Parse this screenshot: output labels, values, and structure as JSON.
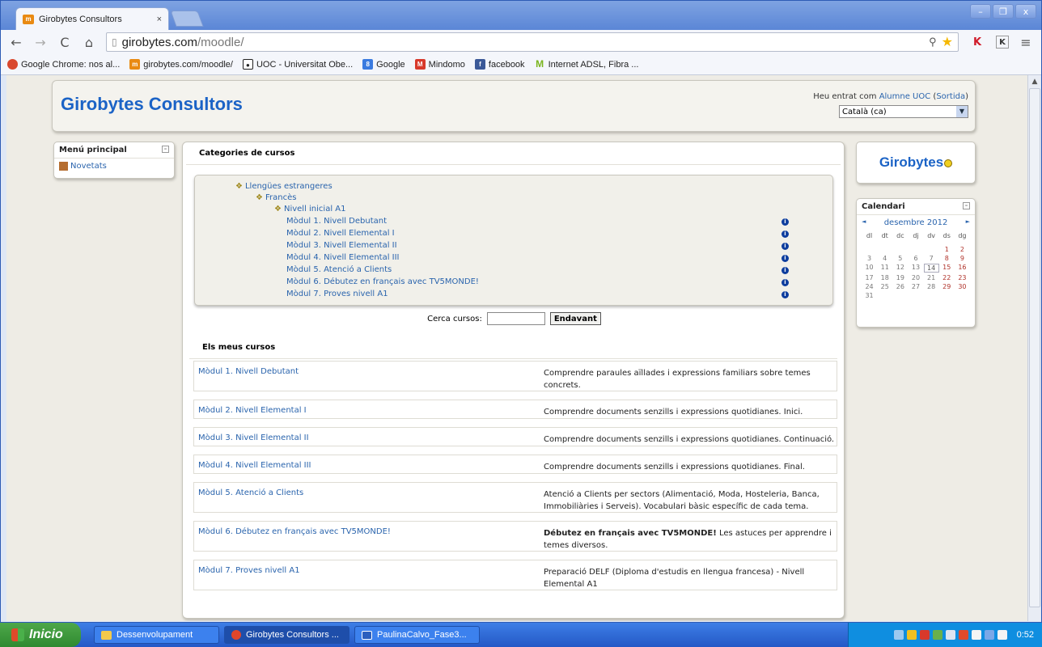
{
  "browser": {
    "tab_title": "Girobytes Consultors",
    "tab_close": "×",
    "url_host": "girobytes.com",
    "url_path": "/moodle/",
    "bookmarks": [
      "Google Chrome: nos al...",
      "girobytes.com/moodle/",
      "UOC - Universitat Obe...",
      "Google",
      "Mindomo",
      "facebook",
      "Internet ADSL, Fibra ..."
    ]
  },
  "header": {
    "site_name": "Girobytes Consultors",
    "login_prefix": "Heu entrat com ",
    "user_name": "Alumne UOC",
    "logout": "Sortida",
    "language": "Català (ca)"
  },
  "main_menu": {
    "title": "Menú principal",
    "items": [
      "Novetats"
    ]
  },
  "categories": {
    "title": "Categories de cursos",
    "level1": "Llengües estrangeres",
    "level2": "Francès",
    "level3": "Nivell inicial A1",
    "modules": [
      "Mòdul 1. Nivell Debutant",
      "Mòdul 2. Nivell Elemental I",
      "Mòdul 3. Nivell Elemental II",
      "Mòdul 4. Nivell Elemental III",
      "Mòdul 5. Atenció a Clients",
      "Mòdul 6. Débutez en français avec TV5MONDE!",
      "Mòdul 7. Proves nivell A1"
    ]
  },
  "search": {
    "label": "Cerca cursos:",
    "button": "Endavant"
  },
  "my_courses": {
    "title": "Els meus cursos",
    "items": [
      {
        "name": "Mòdul 1. Nivell Debutant",
        "desc": "Comprendre paraules aïllades i expressions familiars sobre temes concrets."
      },
      {
        "name": "Mòdul 2. Nivell Elemental I",
        "desc": "Comprendre documents senzills i expressions quotidianes. Inici."
      },
      {
        "name": "Mòdul 3. Nivell Elemental II",
        "desc": "Comprendre documents senzills i expressions quotidianes. Continuació."
      },
      {
        "name": "Mòdul 4. Nivell Elemental III",
        "desc": "Comprendre documents senzills i expressions quotidianes. Final."
      },
      {
        "name": "Mòdul 5. Atenció a Clients",
        "desc": "Atenció a Clients per sectors (Alimentació, Moda, Hosteleria, Banca, Immobiliàries i Serveis). Vocabulari bàsic específic de cada tema."
      },
      {
        "name": "Mòdul 6. Débutez en français avec TV5MONDE!",
        "desc_bold": "Débutez en français avec TV5MONDE!",
        "desc": " Les astuces per apprendre i temes diversos."
      },
      {
        "name": "Mòdul 7. Proves nivell A1",
        "desc": "Preparació DELF (Diploma d'estudis en llengua francesa) - Nivell Elemental A1"
      }
    ]
  },
  "brand_block": {
    "title": "Girobytes"
  },
  "calendar": {
    "title": "Calendari",
    "month": "desembre 2012",
    "prev": "◄",
    "next": "►",
    "weekdays": [
      "dl",
      "dt",
      "dc",
      "dj",
      "dv",
      "ds",
      "dg"
    ],
    "today": "14"
  },
  "taskbar": {
    "start": "Inicio",
    "buttons": [
      "Dessenvolupament",
      "Girobytes Consultors ...",
      "PaulinaCalvo_Fase3..."
    ],
    "clock": "0:52"
  }
}
